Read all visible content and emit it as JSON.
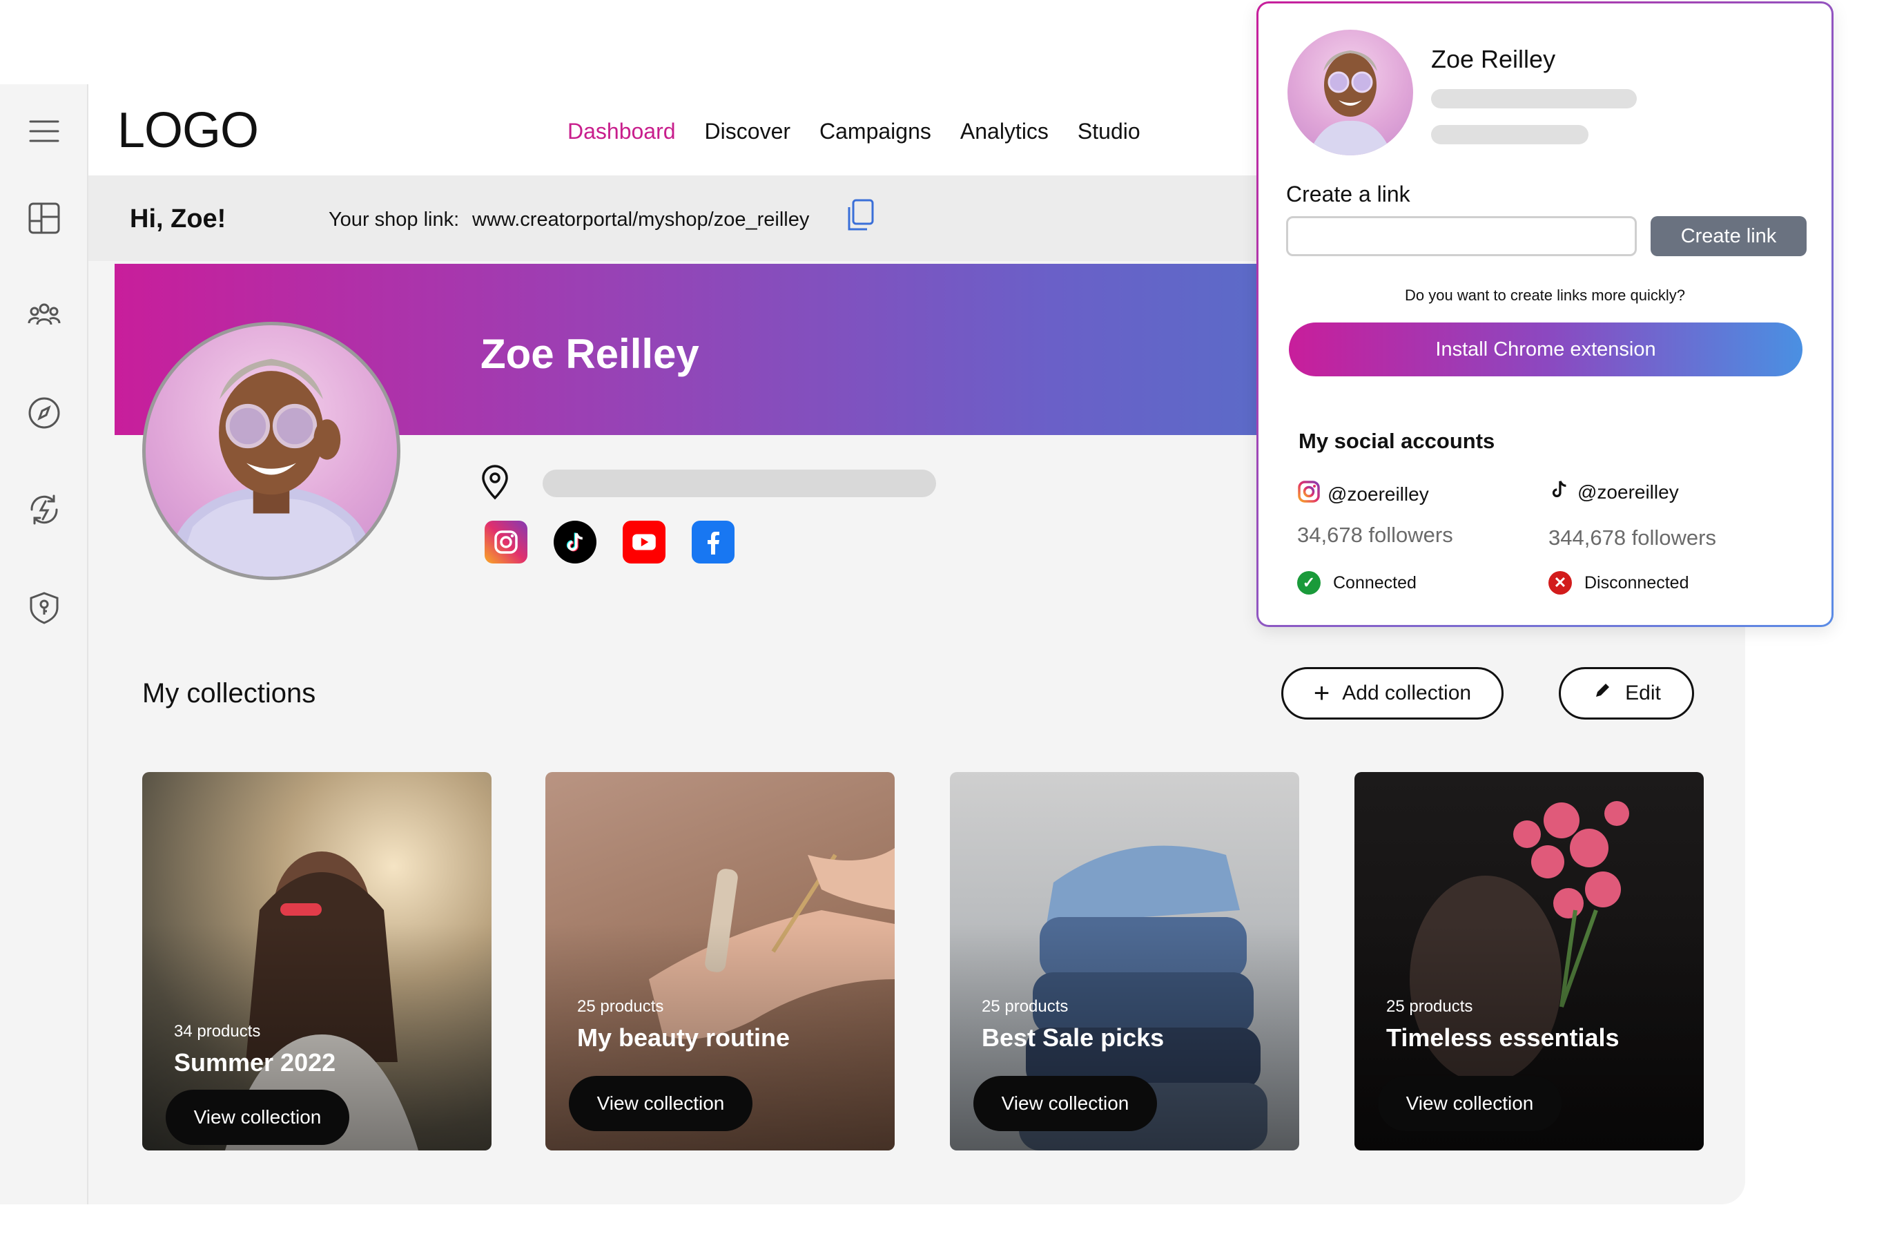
{
  "header": {
    "logo": "LOGO",
    "nav": [
      {
        "label": "Dashboard",
        "active": true
      },
      {
        "label": "Discover"
      },
      {
        "label": "Campaigns"
      },
      {
        "label": "Analytics"
      },
      {
        "label": "Studio"
      }
    ]
  },
  "sidebar": {
    "icons": [
      "menu-icon",
      "dashboard-layout-icon",
      "community-icon",
      "compass-icon",
      "energy-refresh-icon",
      "security-shield-icon"
    ]
  },
  "greeting": {
    "text": "Hi, Zoe!",
    "shop_label": "Your shop link:",
    "shop_url": "www.creatorportal/myshop/zoe_reilley"
  },
  "profile": {
    "name": "Zoe Reilley",
    "socials": [
      "instagram",
      "tiktok",
      "youtube",
      "facebook"
    ]
  },
  "collections": {
    "title": "My collections",
    "add_label": "Add collection",
    "edit_label": "Edit",
    "items": [
      {
        "count": "34 products",
        "title": "Summer 2022",
        "button": "View collection"
      },
      {
        "count": "25 products",
        "title": "My beauty routine",
        "button": "View collection"
      },
      {
        "count": "25 products",
        "title": "Best Sale picks",
        "button": "View collection"
      },
      {
        "count": "25 products",
        "title": "Timeless essentials",
        "button": "View collection"
      }
    ]
  },
  "popup": {
    "name": "Zoe Reilley",
    "create_label": "Create a link",
    "input_value": "",
    "create_button": "Create link",
    "question": "Do you want to create links more quickly?",
    "extension_button": "Install Chrome extension",
    "social_title": "My social accounts",
    "accounts": [
      {
        "platform": "instagram",
        "handle": "@zoereilley",
        "followers": "34,678 followers",
        "status": "Connected",
        "status_color": "#1a9a3a"
      },
      {
        "platform": "tiktok",
        "handle": "@zoereilley",
        "followers": "344,678 followers",
        "status": "Disconnected",
        "status_color": "#d21c1c"
      }
    ]
  },
  "colors": {
    "accent": "#c81e8c",
    "banner_start": "#c81e9b",
    "banner_end": "#5a6cc8",
    "connected": "#1a9a3a",
    "disconnected": "#d21c1c"
  }
}
